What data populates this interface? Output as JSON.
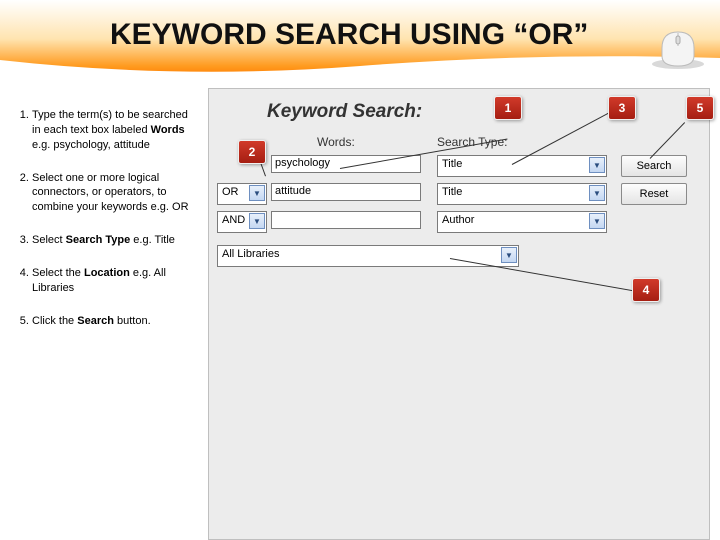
{
  "slide": {
    "title": "KEYWORD SEARCH USING “OR”"
  },
  "instructions": {
    "items": [
      {
        "text_pre": "Type the term(s) to be searched in each text box labeled ",
        "bold1": "Words",
        "text_mid": " e.g. psychology, attitude"
      },
      {
        "text_pre": "Select one or more logical connectors, or operators, to combine your keywords e.g. OR"
      },
      {
        "text_pre": "Select ",
        "bold1": "Search Type",
        "text_mid": " e.g. Title"
      },
      {
        "text_pre": "Select the ",
        "bold1": "Location",
        "text_mid": " e.g. All Libraries"
      },
      {
        "text_pre": "Click the ",
        "bold1": "Search",
        "text_mid": " button."
      }
    ]
  },
  "form": {
    "heading": "Keyword Search:",
    "words_label": "Words:",
    "type_label": "Search Type:",
    "row1": {
      "word": "psychology",
      "type": "Title"
    },
    "row2": {
      "op": "OR",
      "word": "attitude",
      "type": "Title"
    },
    "row3": {
      "op": "AND",
      "word": "",
      "type": "Author"
    },
    "location": "All Libraries",
    "search_btn": "Search",
    "reset_btn": "Reset"
  },
  "callouts": {
    "c1": "1",
    "c2": "2",
    "c3": "3",
    "c4": "4",
    "c5": "5"
  }
}
